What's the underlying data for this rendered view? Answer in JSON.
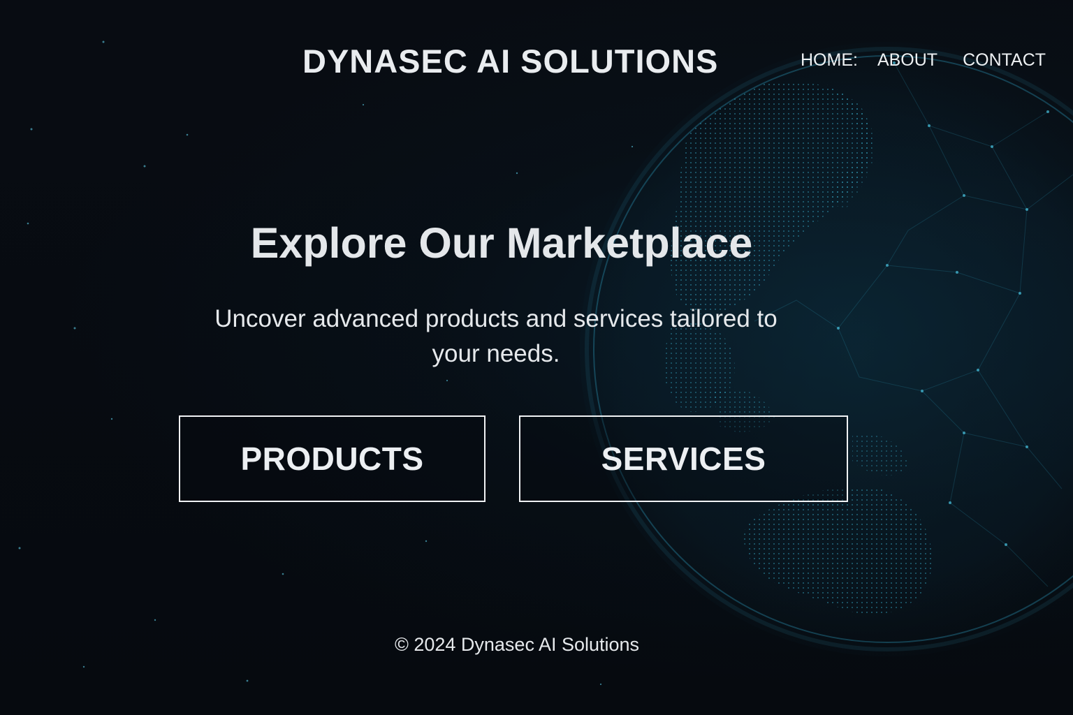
{
  "header": {
    "brand": "DYNASEC AI SOLUTIONS",
    "nav": [
      {
        "label": "HOME:"
      },
      {
        "label": "ABOUT"
      },
      {
        "label": "CONTACT"
      }
    ]
  },
  "hero": {
    "title": "Explore Our Marketplace",
    "subtitle": "Uncover advanced products and services tailored to your needs."
  },
  "actions": {
    "products_label": "PRODUCTS",
    "services_label": "SERVICES"
  },
  "footer": {
    "copyright": "© 2024 Dynasec AI Solutions"
  },
  "colors": {
    "background": "#070b10",
    "globe_accent": "#2fa8c8",
    "text": "#e8ecef"
  }
}
